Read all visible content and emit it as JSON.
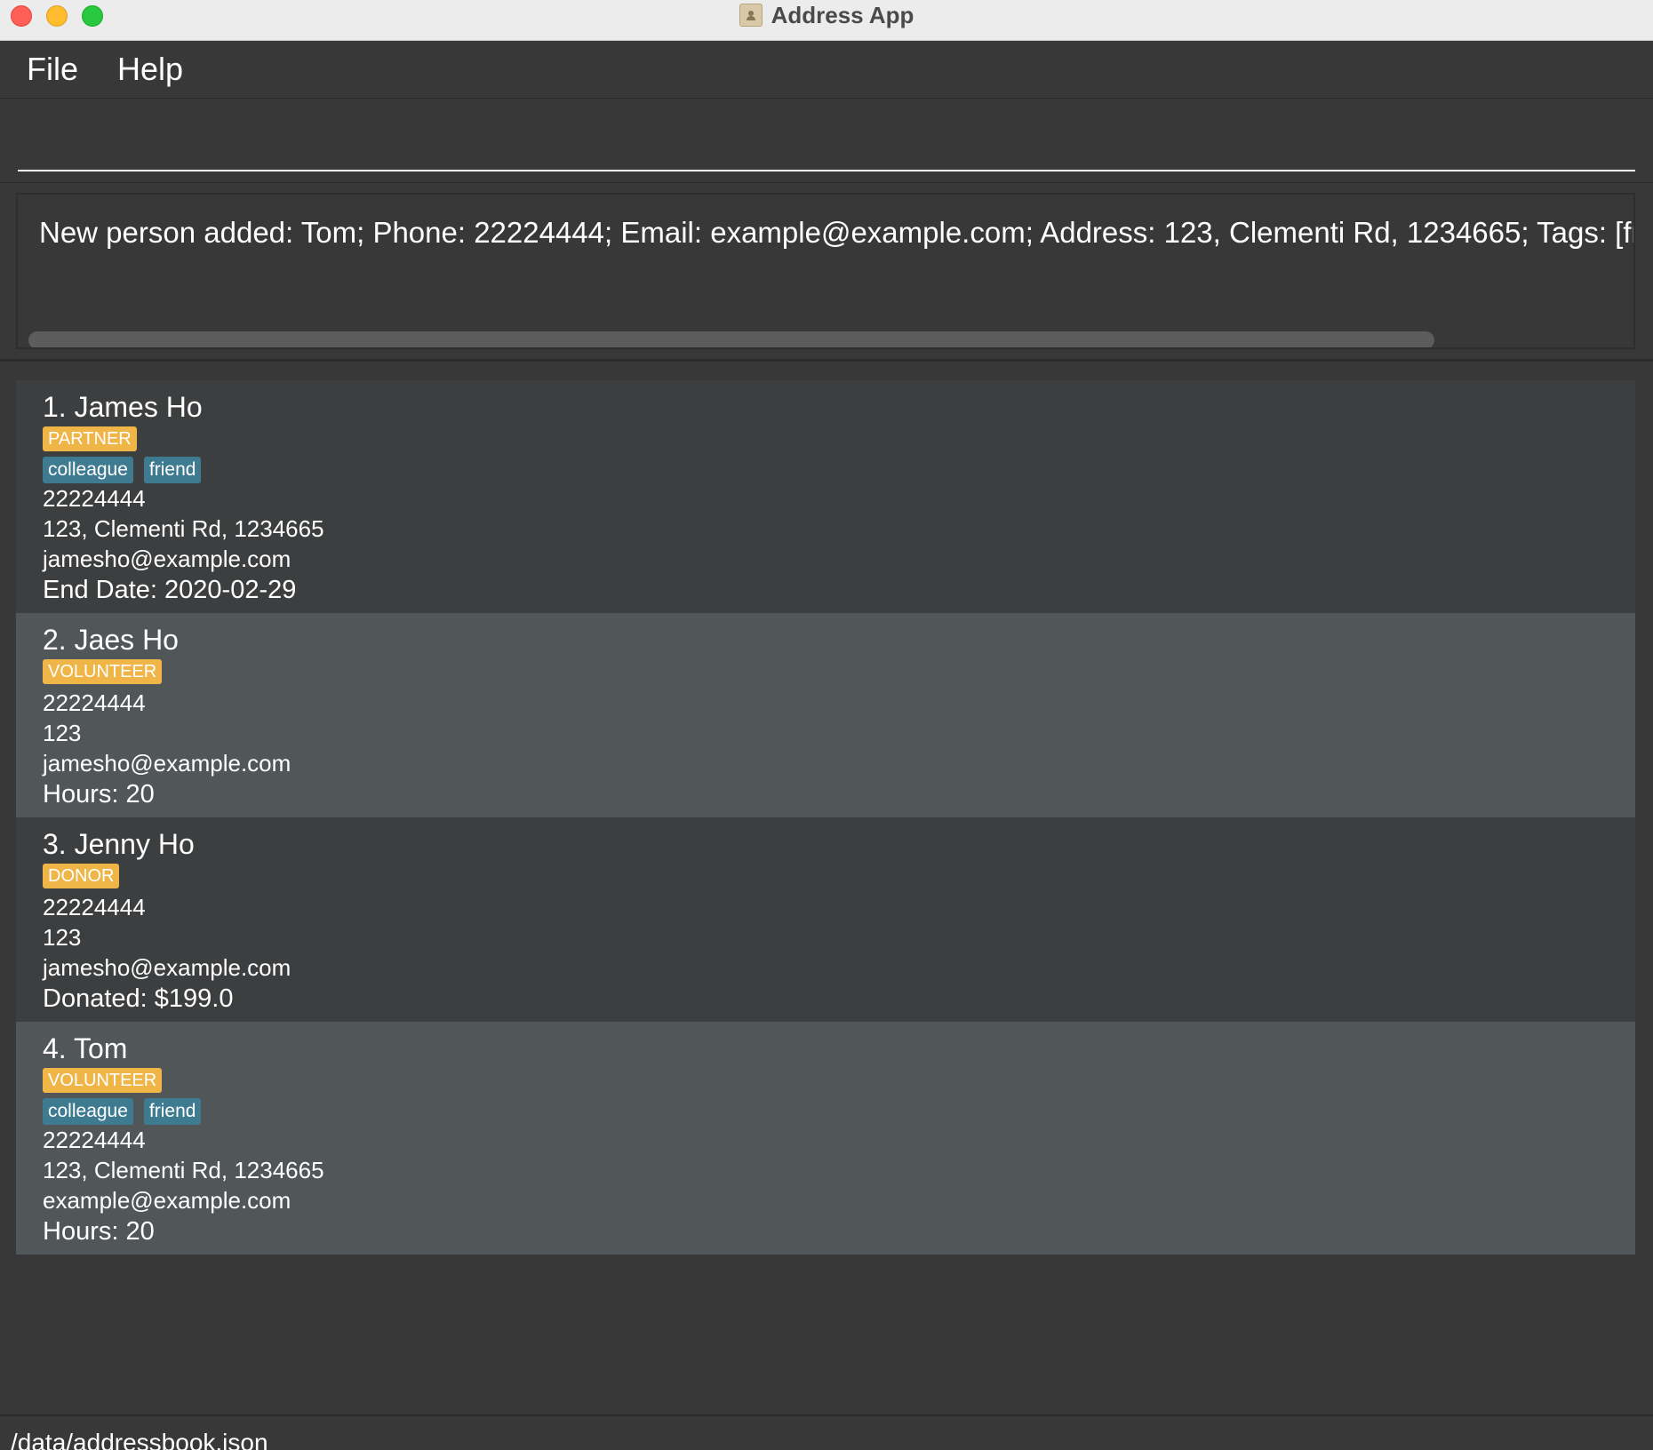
{
  "window": {
    "title": "Address App",
    "controls": [
      "close",
      "minimize",
      "maximize"
    ]
  },
  "menubar": {
    "items": [
      {
        "label": "File"
      },
      {
        "label": "Help"
      }
    ]
  },
  "command_box": {
    "value": "",
    "placeholder": ""
  },
  "result_display": {
    "text": "New person added: Tom; Phone: 22224444; Email: example@example.com; Address: 123, Clementi Rd, 1234665; Tags: [frie"
  },
  "persons": [
    {
      "name": "1. James Ho",
      "role": "PARTNER",
      "tags": [
        "colleague",
        "friend"
      ],
      "phone": "22224444",
      "address": "123, Clementi Rd, 1234665",
      "email": "jamesho@example.com",
      "extra": "End Date: 2020-02-29"
    },
    {
      "name": "2. Jaes Ho",
      "role": "VOLUNTEER",
      "tags": [],
      "phone": "22224444",
      "address": "123",
      "email": "jamesho@example.com",
      "extra": "Hours: 20"
    },
    {
      "name": "3. Jenny Ho",
      "role": "DONOR",
      "tags": [],
      "phone": "22224444",
      "address": "123",
      "email": "jamesho@example.com",
      "extra": "Donated: $199.0"
    },
    {
      "name": "4. Tom",
      "role": "VOLUNTEER",
      "tags": [
        "colleague",
        "friend"
      ],
      "phone": "22224444",
      "address": "123, Clementi Rd, 1234665",
      "email": "example@example.com",
      "extra": "Hours: 20"
    }
  ],
  "status_bar": {
    "path": "/data/addressbook.json"
  },
  "colors": {
    "background": "#383838",
    "card_odd": "#3c3e3f",
    "card_even": "#515658",
    "role_badge": "#f0b547",
    "tag": "#3e7b91"
  }
}
